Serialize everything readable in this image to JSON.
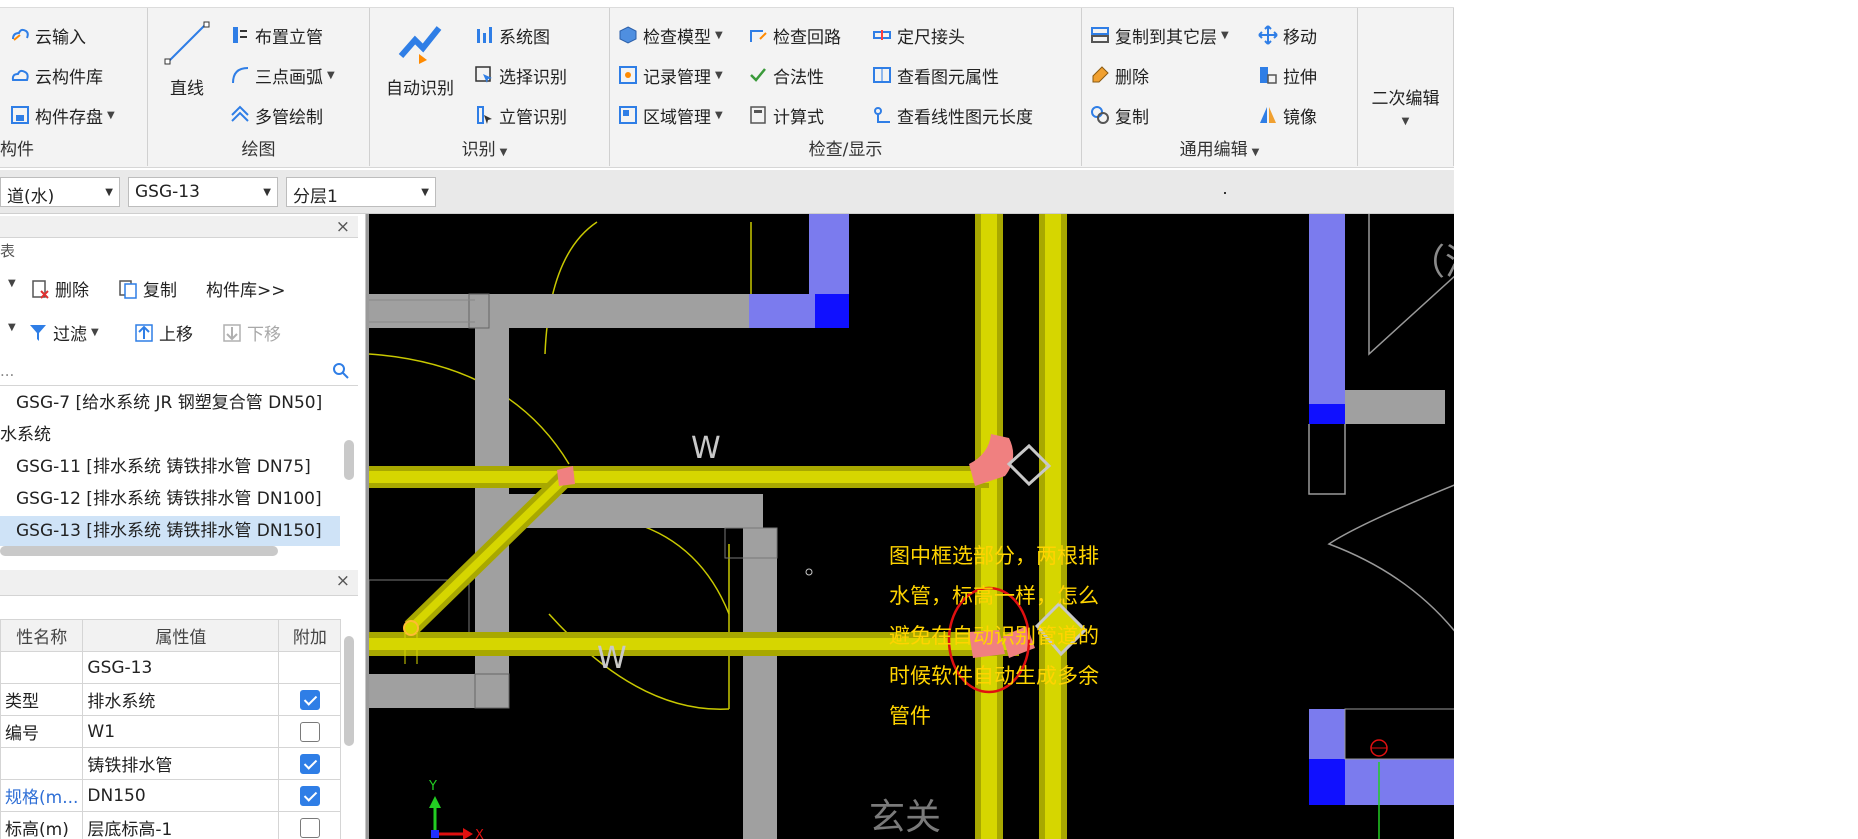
{
  "ribbon": {
    "component_group": {
      "items": [
        "云输入",
        "云构件库",
        "构件存盘"
      ],
      "label": "构件"
    },
    "draw_group": {
      "line_label": "直线",
      "items": [
        "布置立管",
        "三点画弧",
        "多管绘制"
      ],
      "label": "绘图"
    },
    "recognize_group": {
      "auto_label": "自动识别",
      "items": [
        "系统图",
        "选择识别",
        "立管识别"
      ],
      "label": "识别"
    },
    "check_group": {
      "col1": [
        "检查模型",
        "记录管理",
        "区域管理"
      ],
      "col2": [
        "检查回路",
        "合法性",
        "计算式"
      ],
      "col3": [
        "定尺接头",
        "查看图元属性",
        "查看线性图元长度"
      ],
      "label": "检查/显示"
    },
    "edit_group": {
      "col1": [
        "复制到其它层",
        "删除",
        "复制"
      ],
      "col2": [
        "移动",
        "拉伸",
        "镜像"
      ],
      "label": "通用编辑"
    },
    "secondary_edit_label": "二次编辑"
  },
  "selectors": {
    "system": "道(水)",
    "component": "GSG-13",
    "layer": "分层1"
  },
  "component_panel": {
    "title": "表",
    "toolbar": {
      "delete": "删除",
      "copy": "复制",
      "library": "构件库>>",
      "filter": "过滤",
      "move_up": "上移",
      "move_down": "下移"
    },
    "search_placeholder": "...",
    "tree": [
      "GSG-7 [给水系统 JR 钢塑复合管 DN50]",
      "水系统",
      "GSG-11 [排水系统 铸铁排水管 DN75]",
      "GSG-12 [排水系统 铸铁排水管 DN100]",
      "GSG-13 [排水系统 铸铁排水管 DN150]"
    ]
  },
  "property_panel": {
    "headers": [
      "性名称",
      "属性值",
      "附加"
    ],
    "rows": [
      {
        "name": "",
        "value": "GSG-13",
        "checked": null
      },
      {
        "name": "类型",
        "value": "排水系统",
        "checked": true
      },
      {
        "name": "编号",
        "value": "W1",
        "checked": false
      },
      {
        "name": "",
        "value": "铸铁排水管",
        "checked": true
      },
      {
        "name": "规格(m...",
        "value": "DN150",
        "checked": true
      },
      {
        "name": "标高(m)",
        "value": "层底标高-1",
        "checked": false
      }
    ]
  },
  "drawing": {
    "pipe_labels": [
      "W",
      "W"
    ],
    "room_text": "（消",
    "corner_text": "玄关",
    "axis_x": "X",
    "axis_y": "Y",
    "annotation_lines": [
      "图中框选部分，两根排",
      "水管，标高一样，怎么",
      "避免在自动识别管道的",
      "时候软件自动生成多余",
      "管件"
    ]
  },
  "colors": {
    "pipe_yellow": "#d6d600",
    "wall_gray": "#a0a0a0",
    "fitting_pink": "#f08080",
    "blue_block": "#7b7bee",
    "accent_blue": "#2f7ee6",
    "highlight_red": "#e01010"
  }
}
